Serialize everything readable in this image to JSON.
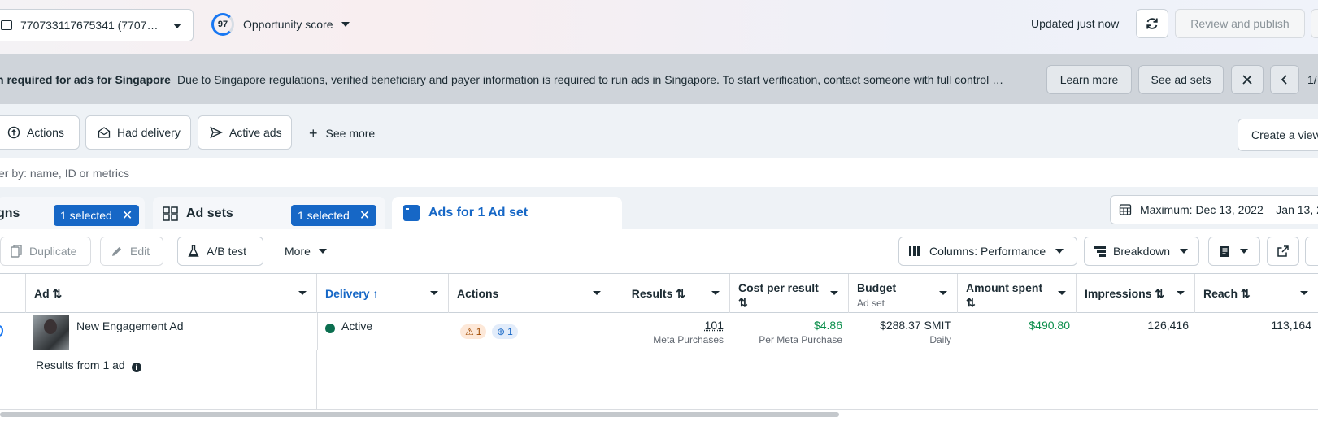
{
  "topbar": {
    "account": "770733117675341 (7707…",
    "score_value": "97",
    "score_label": "Opportunity score",
    "updated": "Updated just now",
    "review_publish": "Review and publish"
  },
  "banner": {
    "title": "n required for ads for Singapore",
    "text": "Due to Singapore regulations, verified beneficiary and payer information is required to run ads in Singapore. To start verification, contact someone with full control …",
    "learn_more": "Learn more",
    "see_ad_sets": "See ad sets",
    "pager": "1/"
  },
  "filters": {
    "chips": [
      {
        "label": "Actions",
        "icon": "arrow-up-circle-icon"
      },
      {
        "label": "Had delivery",
        "icon": "envelope-open-icon"
      },
      {
        "label": "Active ads",
        "icon": "send-icon"
      }
    ],
    "see_more": "See more",
    "create_view": "Create a view"
  },
  "search": {
    "placeholder": "er by: name, ID or metrics"
  },
  "tabs": {
    "campaigns_label": "gns",
    "campaigns_selected": "1 selected",
    "adsets_label": "Ad sets",
    "adsets_selected": "1 selected",
    "ads_label": "Ads for 1 Ad set",
    "date_range": "Maximum: Dec 13, 2022 – Jan 13, 2"
  },
  "toolbar": {
    "duplicate": "Duplicate",
    "edit": "Edit",
    "ab_test": "A/B test",
    "more": "More",
    "columns": "Columns: Performance",
    "breakdown": "Breakdown"
  },
  "table": {
    "headers": {
      "ad": "Ad ⇅",
      "delivery": "Delivery ↑",
      "actions": "Actions",
      "results": "Results ⇅",
      "cost_per_result": "Cost per result",
      "cost_sort": "⇅",
      "budget": "Budget",
      "budget_sub": "Ad set",
      "amount_spent": "Amount spent",
      "amount_sort": "⇅",
      "impressions": "Impressions ⇅",
      "reach": "Reach ⇅"
    },
    "row": {
      "name": "New Engagement Ad",
      "status": "Active",
      "warn_count": "1",
      "action_count": "1",
      "results": "101",
      "results_sub": "Meta Purchases",
      "cost": "$4.86",
      "cost_sub": "Per Meta Purchase",
      "budget": "$288.37 SMIT",
      "budget_sub": "Daily",
      "amount_spent": "$490.80",
      "impressions": "126,416",
      "reach": "113,164"
    },
    "footer": "Results from 1 ad"
  },
  "colors": {
    "brand_blue": "#1667c6",
    "active_green": "#0b6e4f",
    "money_green": "#0b8e4b"
  }
}
